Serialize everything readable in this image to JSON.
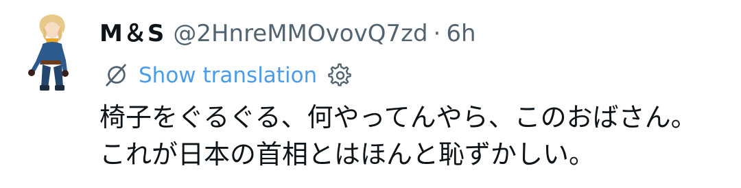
{
  "tweet": {
    "display_name": "M＆S",
    "handle": "@2HnreMMOvovQ7zd",
    "separator": "·",
    "time": "6h",
    "translate_label": "Show translation",
    "lines": [
      "椅子をぐるぐる、何やってんやら、このおばさん。",
      "これが日本の首相とはほんと恥ずかしい。"
    ]
  },
  "icons": {
    "translate": "translate-globe-icon",
    "settings": "gear-icon"
  },
  "colors": {
    "link": "#4a9ce8",
    "muted": "#536471",
    "text": "#0f1419"
  }
}
